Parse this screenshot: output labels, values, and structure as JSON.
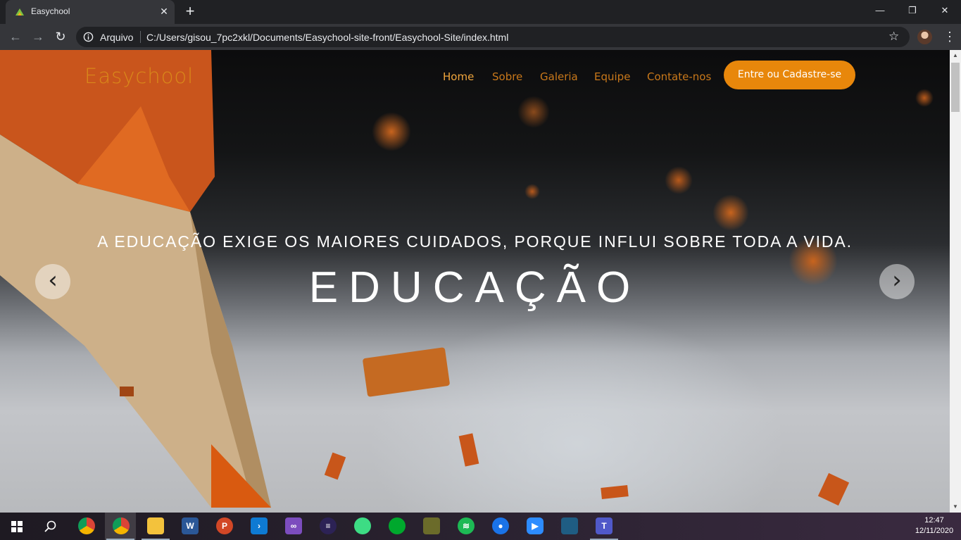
{
  "browser": {
    "tab_title": "Easychool",
    "tab_close": "✕",
    "new_tab": "+",
    "window_controls": {
      "minimize": "—",
      "maximize": "❐",
      "close": "✕"
    },
    "nav": {
      "back": "←",
      "forward": "→",
      "reload": "↻"
    },
    "scheme_label": "Arquivo",
    "url": "C:/Users/gisou_7pc2xkl/Documents/Easychool-site-front/Easychool-Site/index.html",
    "star": "☆",
    "menu": "⋮"
  },
  "site": {
    "brand": "Easychool",
    "nav": [
      "Home",
      "Sobre",
      "Galeria",
      "Equipe",
      "Contate-nos"
    ],
    "active_nav": "Home",
    "cta": "Entre ou Cadastre-se",
    "hero": {
      "quote": "A EDUCAÇÃO EXIGE OS MAIORES CUIDADOS, PORQUE INFLUI SOBRE TODA A VIDA.",
      "headline": "EDUCAÇÃO",
      "prev": "‹",
      "next": "›"
    },
    "colors": {
      "accent": "#e8870b",
      "nav_text": "#c9781a"
    }
  },
  "taskbar": {
    "icons": [
      "windows-start",
      "search",
      "chrome",
      "chrome-profile",
      "file-explorer",
      "word",
      "powerpoint",
      "vscode",
      "visual-studio",
      "eclipse",
      "android-studio",
      "evernote",
      "app",
      "spotify",
      "maps",
      "zoom",
      "mysql-workbench",
      "teams"
    ],
    "time": "12:47",
    "date": "12/11/2020"
  }
}
